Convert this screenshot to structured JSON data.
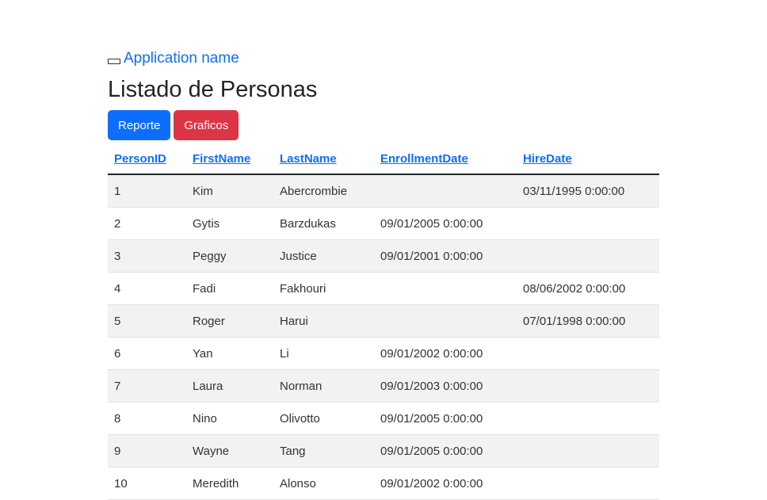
{
  "app": {
    "name": "Application name"
  },
  "page": {
    "title": "Listado de Personas"
  },
  "buttons": {
    "reporte": "Reporte",
    "graficos": "Graficos"
  },
  "table": {
    "headers": [
      "PersonID",
      "FirstName",
      "LastName",
      "EnrollmentDate",
      "HireDate"
    ],
    "rows": [
      [
        "1",
        "Kim",
        "Abercrombie",
        "",
        "03/11/1995 0:00:00"
      ],
      [
        "2",
        "Gytis",
        "Barzdukas",
        "09/01/2005 0:00:00",
        ""
      ],
      [
        "3",
        "Peggy",
        "Justice",
        "09/01/2001 0:00:00",
        ""
      ],
      [
        "4",
        "Fadi",
        "Fakhouri",
        "",
        "08/06/2002 0:00:00"
      ],
      [
        "5",
        "Roger",
        "Harui",
        "",
        "07/01/1998 0:00:00"
      ],
      [
        "6",
        "Yan",
        "Li",
        "09/01/2002 0:00:00",
        ""
      ],
      [
        "7",
        "Laura",
        "Norman",
        "09/01/2003 0:00:00",
        ""
      ],
      [
        "8",
        "Nino",
        "Olivotto",
        "09/01/2005 0:00:00",
        ""
      ],
      [
        "9",
        "Wayne",
        "Tang",
        "09/01/2005 0:00:00",
        ""
      ],
      [
        "10",
        "Meredith",
        "Alonso",
        "09/01/2002 0:00:00",
        ""
      ]
    ]
  }
}
